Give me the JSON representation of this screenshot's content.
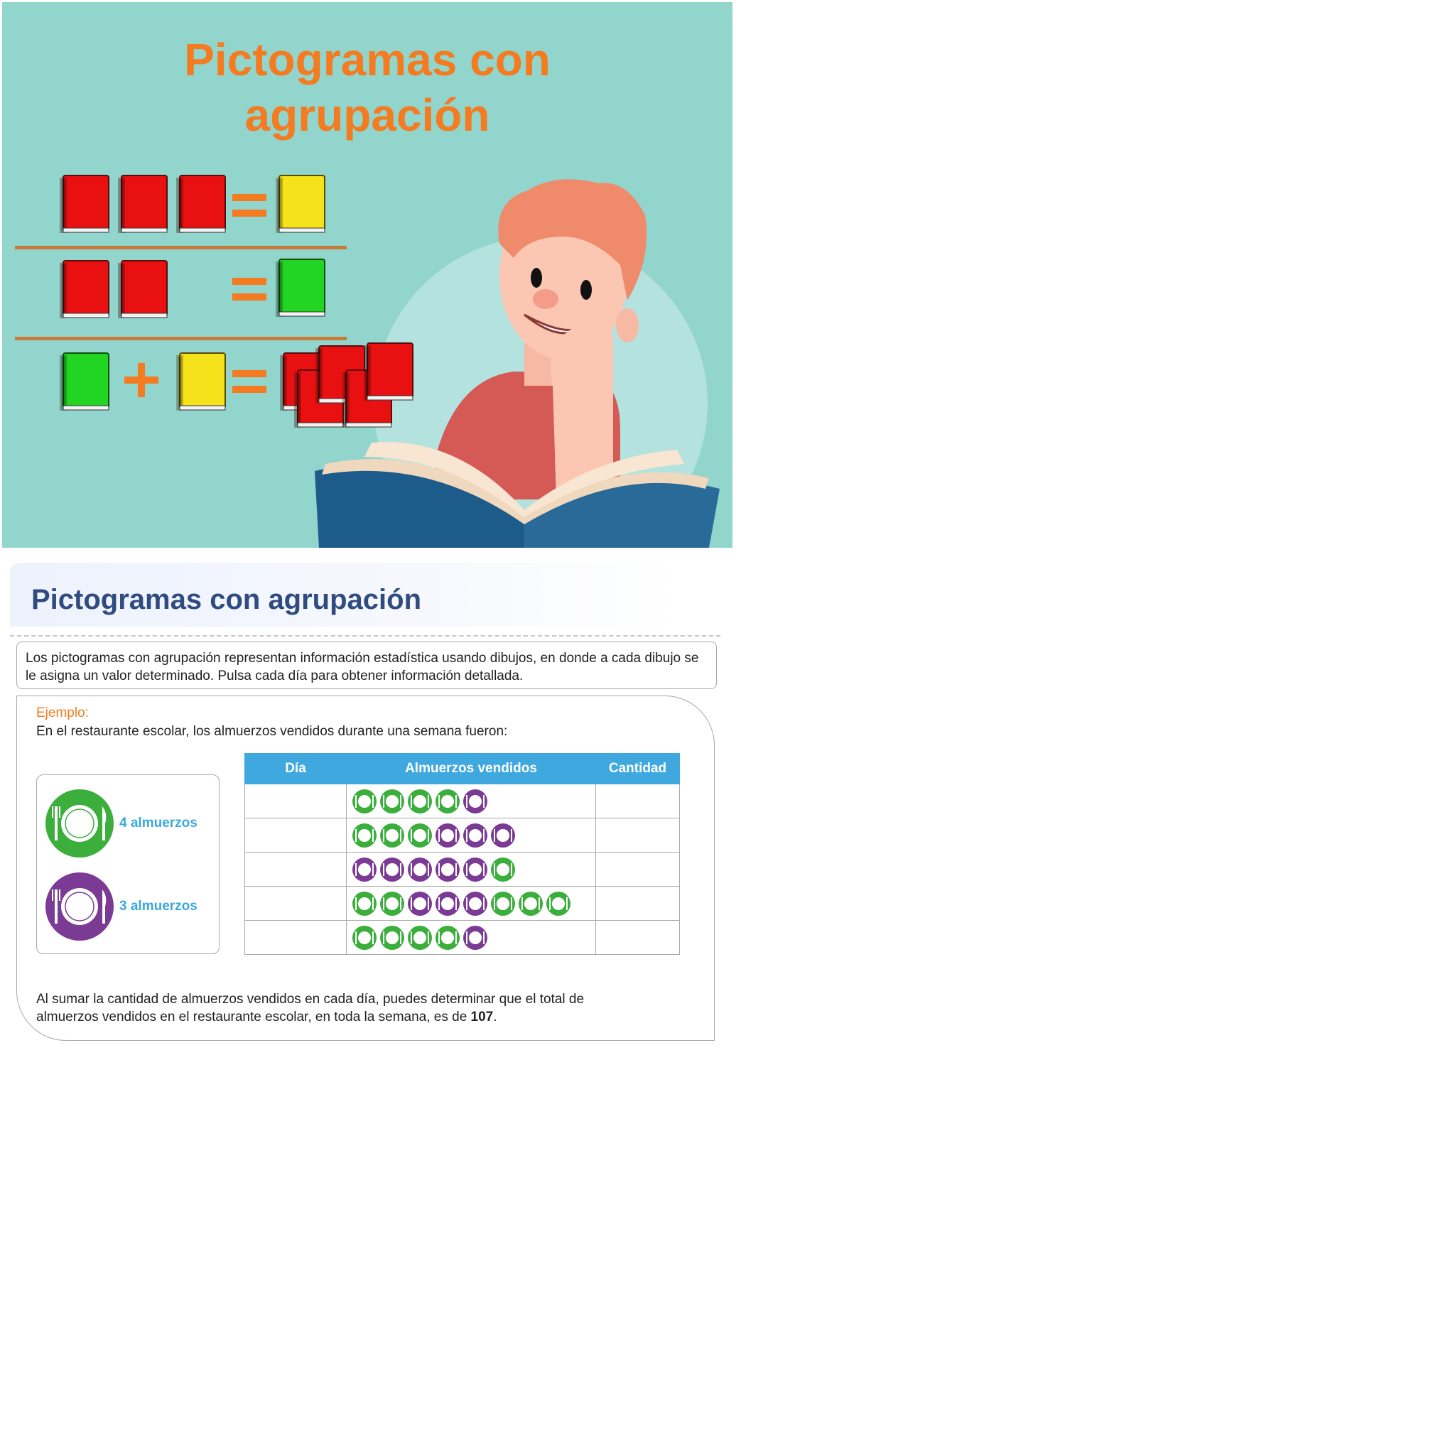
{
  "hero": {
    "title_line1": "Pictogramas con",
    "title_line2": "agrupación"
  },
  "section": {
    "title": "Pictogramas con agrupación",
    "intro": "Los pictogramas con agrupación representan información estadística usando dibujos, en donde a cada dibujo se le asigna un valor determinado. Pulsa cada día para obtener información detallada."
  },
  "example": {
    "label": "Ejemplo:",
    "text": "En el restaurante escolar, los almuerzos vendidos durante una semana fueron:",
    "legend": [
      {
        "color": "green",
        "hex": "#3bae3c",
        "icon": "plate-cutlery-icon",
        "label": "4 almuerzos"
      },
      {
        "color": "purple",
        "hex": "#7b3a93",
        "icon": "plate-cutlery-icon",
        "label": "3 almuerzos"
      }
    ],
    "table": {
      "headers": [
        "Día",
        "Almuerzos vendidos",
        "Cantidad"
      ],
      "rows": [
        {
          "dia": "",
          "icons": [
            "green",
            "green",
            "green",
            "green",
            "purple"
          ],
          "cantidad": ""
        },
        {
          "dia": "",
          "icons": [
            "green",
            "green",
            "green",
            "purple",
            "purple",
            "purple"
          ],
          "cantidad": ""
        },
        {
          "dia": "",
          "icons": [
            "purple",
            "purple",
            "purple",
            "purple",
            "purple",
            "green"
          ],
          "cantidad": ""
        },
        {
          "dia": "",
          "icons": [
            "green",
            "green",
            "purple",
            "purple",
            "purple",
            "green",
            "green",
            "green"
          ],
          "cantidad": ""
        },
        {
          "dia": "",
          "icons": [
            "green",
            "green",
            "green",
            "green",
            "purple"
          ],
          "cantidad": ""
        }
      ]
    },
    "conclusion_before": "Al sumar la cantidad de almuerzos vendidos en cada día, puedes determinar que el total de almuerzos vendidos en el restaurante escolar, en toda la semana, es de ",
    "conclusion_total": "107",
    "conclusion_after": "."
  },
  "colors": {
    "hero_bg": "#92d5cd",
    "title_orange": "#f47b20",
    "header_blue": "#3fa8df",
    "heading_navy": "#2f4b80"
  }
}
